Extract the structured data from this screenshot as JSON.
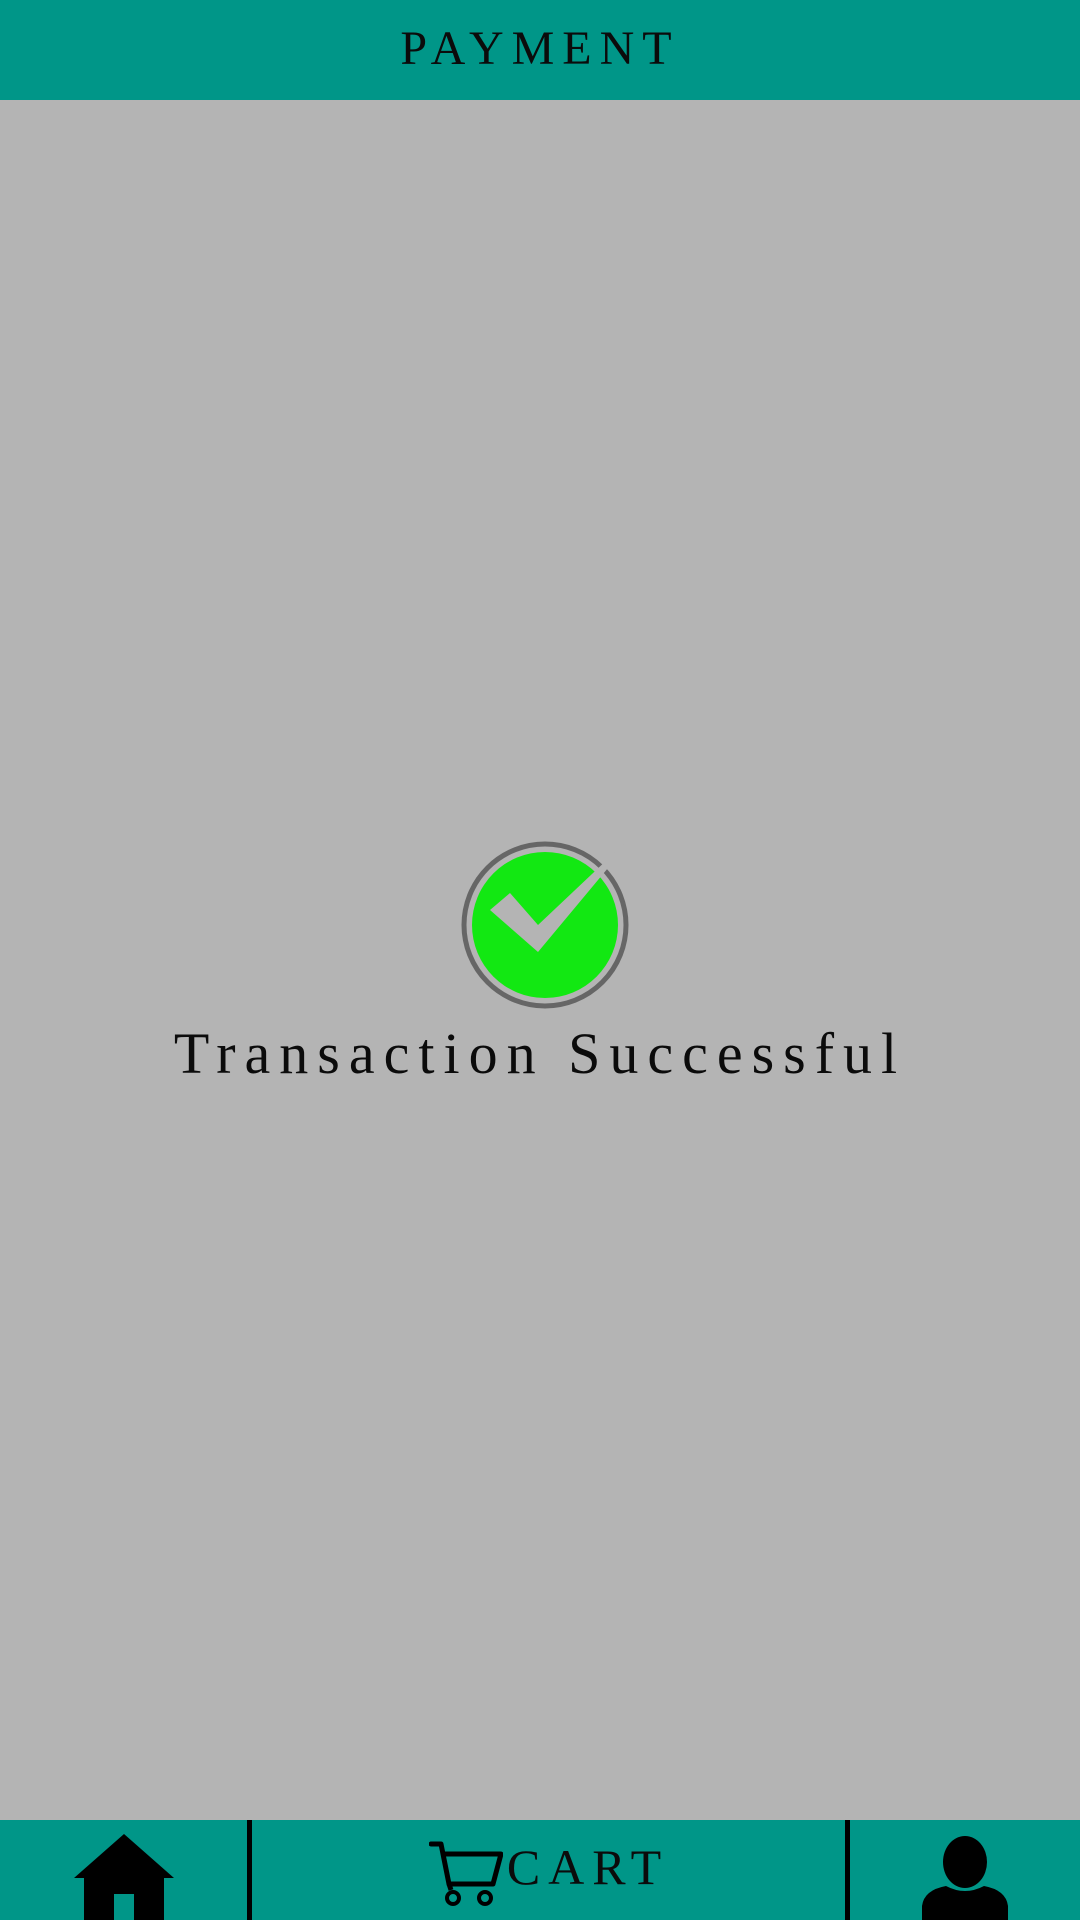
{
  "header": {
    "title": "PAYMENT"
  },
  "main": {
    "status_message": "Transaction Successful",
    "status_icon": "check-circle-icon"
  },
  "bottom_nav": {
    "home_icon": "home-icon",
    "cart_icon": "cart-icon",
    "cart_label": "CART",
    "profile_icon": "user-icon"
  },
  "colors": {
    "header_bg": "#009688",
    "nav_bg": "#009688",
    "page_bg": "#b4b4b4",
    "success_green": "#12e812",
    "ring_gray": "#666666"
  }
}
